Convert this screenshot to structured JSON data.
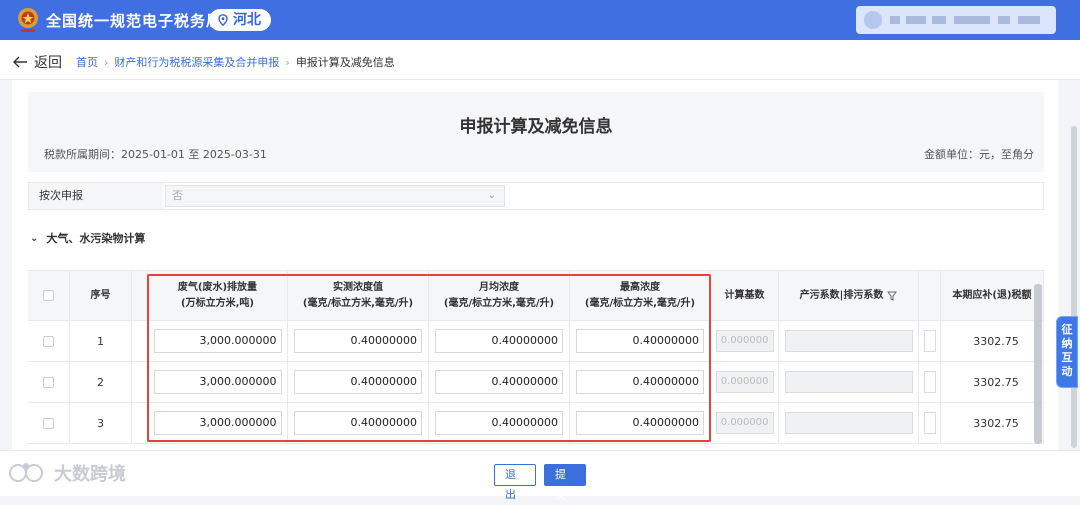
{
  "header": {
    "app_title": "全国统一规范电子税务局",
    "region": "河北",
    "logo_icon": "tax-emblem-icon",
    "location_icon": "location-pin-icon"
  },
  "nav": {
    "back_label": "返回",
    "breadcrumb": [
      "首页",
      "财产和行为税税源采集及合并申报",
      "申报计算及减免信息"
    ]
  },
  "form": {
    "title": "申报计算及减免信息",
    "period": "税款所属期间：2025-01-01 至 2025-03-31",
    "unit": "金额单位：元，至角分",
    "by_time_label": "按次申报",
    "by_time_value": "否",
    "section_title": "大气、水污染物计算"
  },
  "table": {
    "headers": {
      "index": "序号",
      "emission_l1": "废气(废水)排放量",
      "emission_l2": "(万标立方米,吨)",
      "measured_l1": "实测浓度值",
      "measured_l2": "(毫克/标立方米,毫克/升)",
      "monthly_l1": "月均浓度",
      "monthly_l2": "(毫克/标立方米,毫克/升)",
      "max_l1": "最高浓度",
      "max_l2": "(毫克/标立方米,毫克/升)",
      "base": "计算基数",
      "coef": "产污系数|排污系数",
      "tax": "本期应补(退)税额"
    },
    "rows": [
      {
        "index": "1",
        "emission": "3,000.000000",
        "measured": "0.40000000",
        "monthly": "0.40000000",
        "max": "0.40000000",
        "base": "0.000000",
        "tax": "3302.75"
      },
      {
        "index": "2",
        "emission": "3,000.000000",
        "measured": "0.40000000",
        "monthly": "0.40000000",
        "max": "0.40000000",
        "base": "0.000000",
        "tax": "3302.75"
      },
      {
        "index": "3",
        "emission": "3,000.000000",
        "measured": "0.40000000",
        "monthly": "0.40000000",
        "max": "0.40000000",
        "base": "0.000000",
        "tax": "3302.75"
      }
    ]
  },
  "side_widget": {
    "lines": [
      "征",
      "纳",
      "互",
      "动"
    ]
  },
  "footer": {
    "exit_label": "退出",
    "submit_label": "提交",
    "watermark": "大数跨境"
  }
}
